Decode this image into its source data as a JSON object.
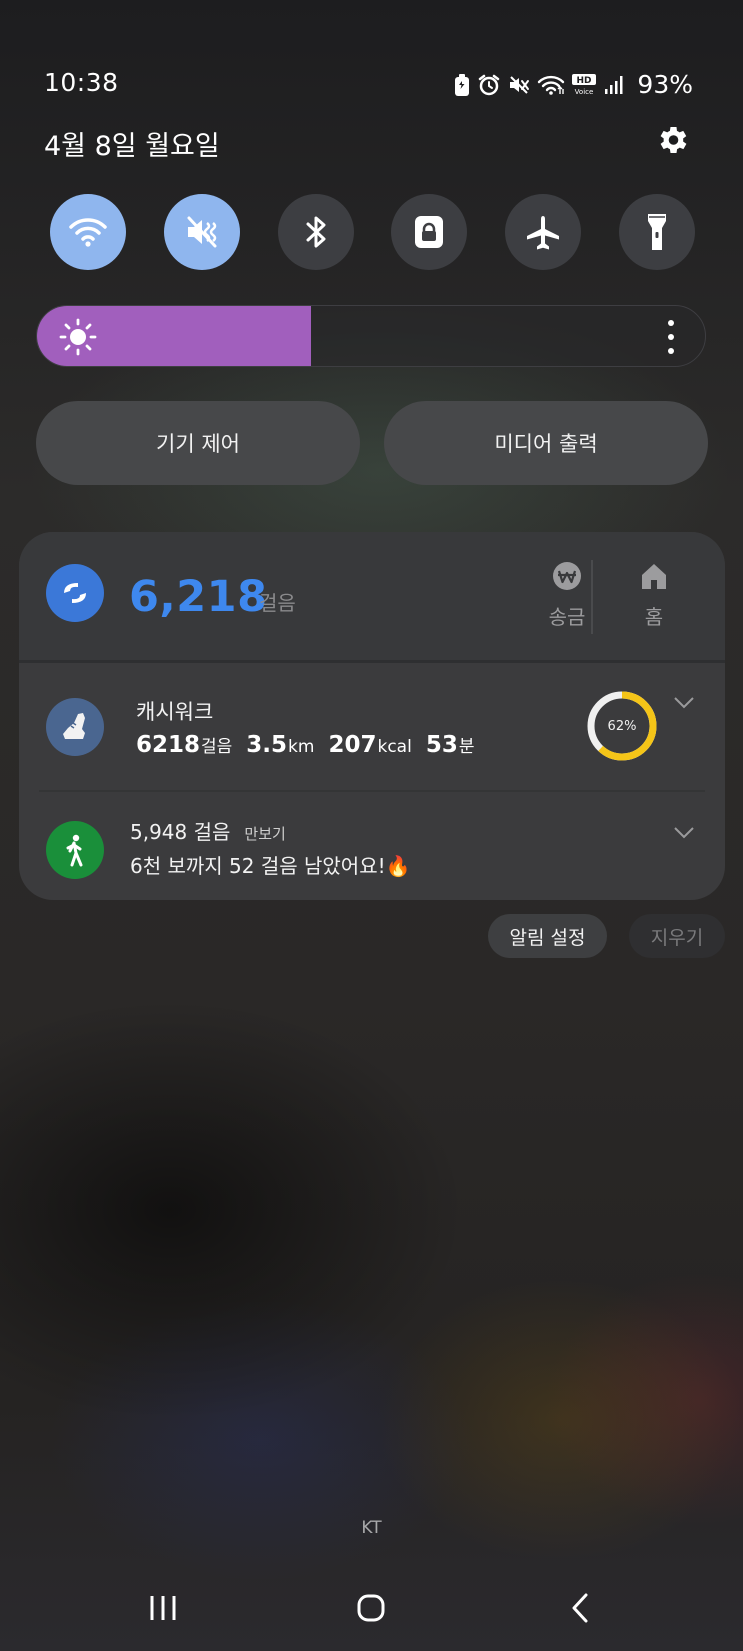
{
  "status_bar": {
    "time": "10:38",
    "battery_percent": "93%",
    "icons": [
      "battery-saver-icon",
      "alarm-icon",
      "mute-icon",
      "wifi-icon",
      "hd-voice-icon",
      "signal-icon"
    ],
    "hd_text": "HD",
    "voice_text": "Voice"
  },
  "header": {
    "date": "4월 8일 월요일",
    "settings_icon": "gear-icon"
  },
  "quick_toggles": [
    {
      "name": "wifi",
      "icon": "wifi-icon",
      "active": true
    },
    {
      "name": "sound",
      "icon": "mute-icon",
      "active": true
    },
    {
      "name": "bluetooth",
      "icon": "bluetooth-icon",
      "active": false
    },
    {
      "name": "rotation-lock",
      "icon": "lock-icon",
      "active": false
    },
    {
      "name": "airplane",
      "icon": "airplane-icon",
      "active": false
    },
    {
      "name": "flashlight",
      "icon": "flashlight-icon",
      "active": false
    }
  ],
  "brightness": {
    "level": 0.41,
    "fill_color": "#a15fbd"
  },
  "panel_buttons": {
    "device_control": "기기 제어",
    "media_output": "미디어 출력"
  },
  "samsung_health": {
    "steps": "6,218",
    "unit": "걸음",
    "shortcuts": [
      {
        "label": "송금",
        "icon": "won-icon"
      },
      {
        "label": "홈",
        "icon": "home-icon"
      }
    ]
  },
  "cashwalk": {
    "title": "캐시워크",
    "steps_value": "6218",
    "steps_unit": "걸음",
    "distance_value": "3.5",
    "distance_unit": "km",
    "calories_value": "207",
    "calories_unit": "kcal",
    "time_value": "53",
    "time_unit": "분",
    "progress_label": "62%",
    "progress": 0.62,
    "ring_color": "#f5c518"
  },
  "pedometer": {
    "steps": "5,948 걸음",
    "app_name": "만보기",
    "message": "6천 보까지 52 걸음 남았어요!🔥"
  },
  "notification_actions": {
    "settings": "알림 설정",
    "clear": "지우기"
  },
  "carrier": "KT",
  "colors": {
    "accent_blue": "#3e88ee",
    "toggle_on": "#8fb6ee",
    "walk_green": "#1a8f3a"
  }
}
